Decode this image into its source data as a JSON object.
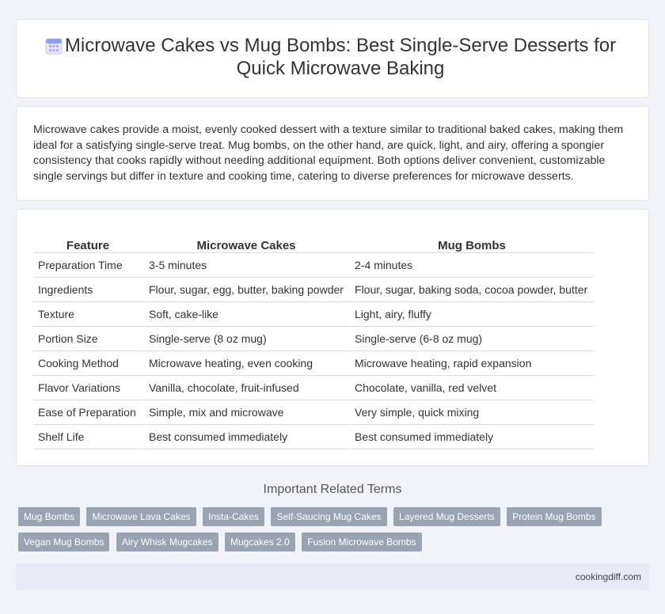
{
  "header": {
    "icon": "calendar-icon",
    "title": "Microwave Cakes vs Mug Bombs: Best Single-Serve Desserts for Quick Microwave Baking"
  },
  "summary": "Microwave cakes provide a moist, evenly cooked dessert with a texture similar to traditional baked cakes, making them ideal for a satisfying single-serve treat. Mug bombs, on the other hand, are quick, light, and airy, offering a spongier consistency that cooks rapidly without needing additional equipment. Both options deliver convenient, customizable single servings but differ in texture and cooking time, catering to diverse preferences for microwave desserts.",
  "table": {
    "headers": [
      "Feature",
      "Microwave Cakes",
      "Mug Bombs"
    ],
    "rows": [
      [
        "Preparation Time",
        "3-5 minutes",
        "2-4 minutes"
      ],
      [
        "Ingredients",
        "Flour, sugar, egg, butter, baking powder",
        "Flour, sugar, baking soda, cocoa powder, butter"
      ],
      [
        "Texture",
        "Soft, cake-like",
        "Light, airy, fluffy"
      ],
      [
        "Portion Size",
        "Single-serve (8 oz mug)",
        "Single-serve (6-8 oz mug)"
      ],
      [
        "Cooking Method",
        "Microwave heating, even cooking",
        "Microwave heating, rapid expansion"
      ],
      [
        "Flavor Variations",
        "Vanilla, chocolate, fruit-infused",
        "Chocolate, vanilla, red velvet"
      ],
      [
        "Ease of Preparation",
        "Simple, mix and microwave",
        "Very simple, quick mixing"
      ],
      [
        "Shelf Life",
        "Best consumed immediately",
        "Best consumed immediately"
      ]
    ]
  },
  "related": {
    "title": "Important Related Terms",
    "tags": [
      "Mug Bombs",
      "Microwave Lava Cakes",
      "Insta-Cakes",
      "Self-Saucing Mug Cakes",
      "Layered Mug Desserts",
      "Protein Mug Bombs",
      "Vegan Mug Bombs",
      "Airy Whisk Mugcakes",
      "Mugcakes 2.0",
      "Fusion Microwave Bombs"
    ]
  },
  "footer": {
    "site": "cookingdiff.com"
  }
}
